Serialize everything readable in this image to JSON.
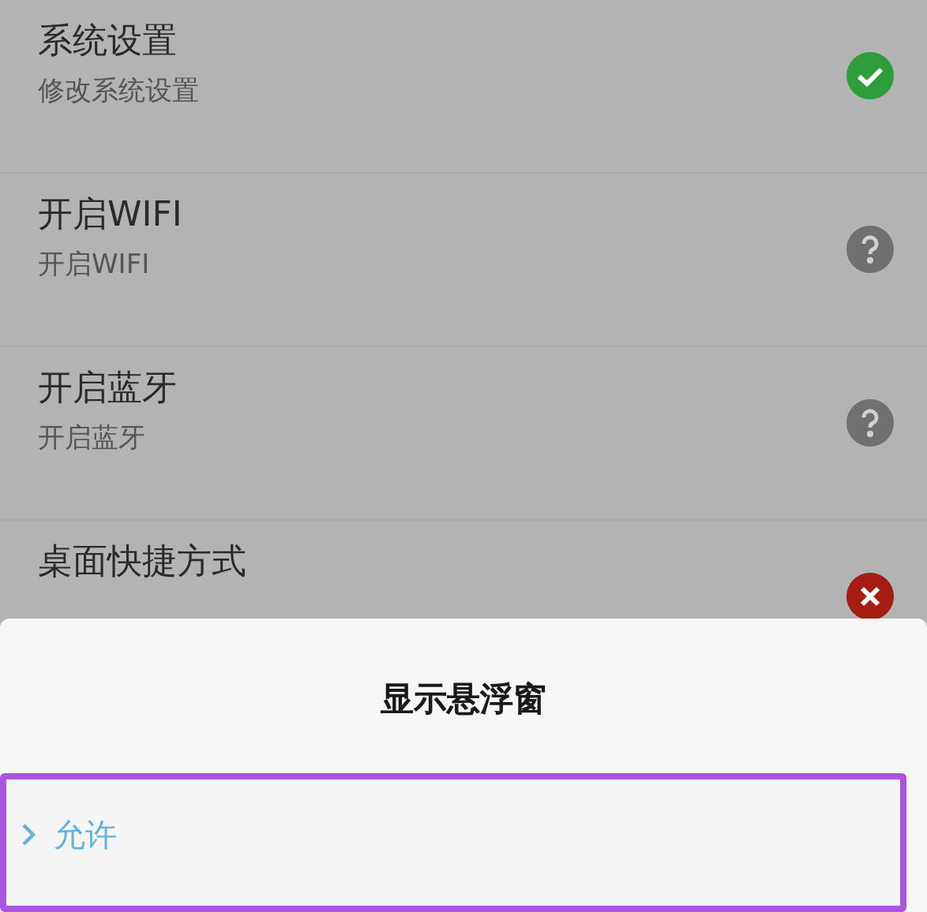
{
  "permissions": [
    {
      "title": "系统设置",
      "subtitle": "修改系统设置",
      "kind": "granted"
    },
    {
      "title": "开启WIFI",
      "subtitle": "开启WIFI",
      "kind": "unknown"
    },
    {
      "title": "开启蓝牙",
      "subtitle": "开启蓝牙",
      "kind": "unknown"
    },
    {
      "title": "桌面快捷方式",
      "kind": "denied"
    }
  ],
  "sheet": {
    "title": "显示悬浮窗",
    "options": [
      {
        "label": "允许",
        "highlighted": true
      }
    ]
  }
}
